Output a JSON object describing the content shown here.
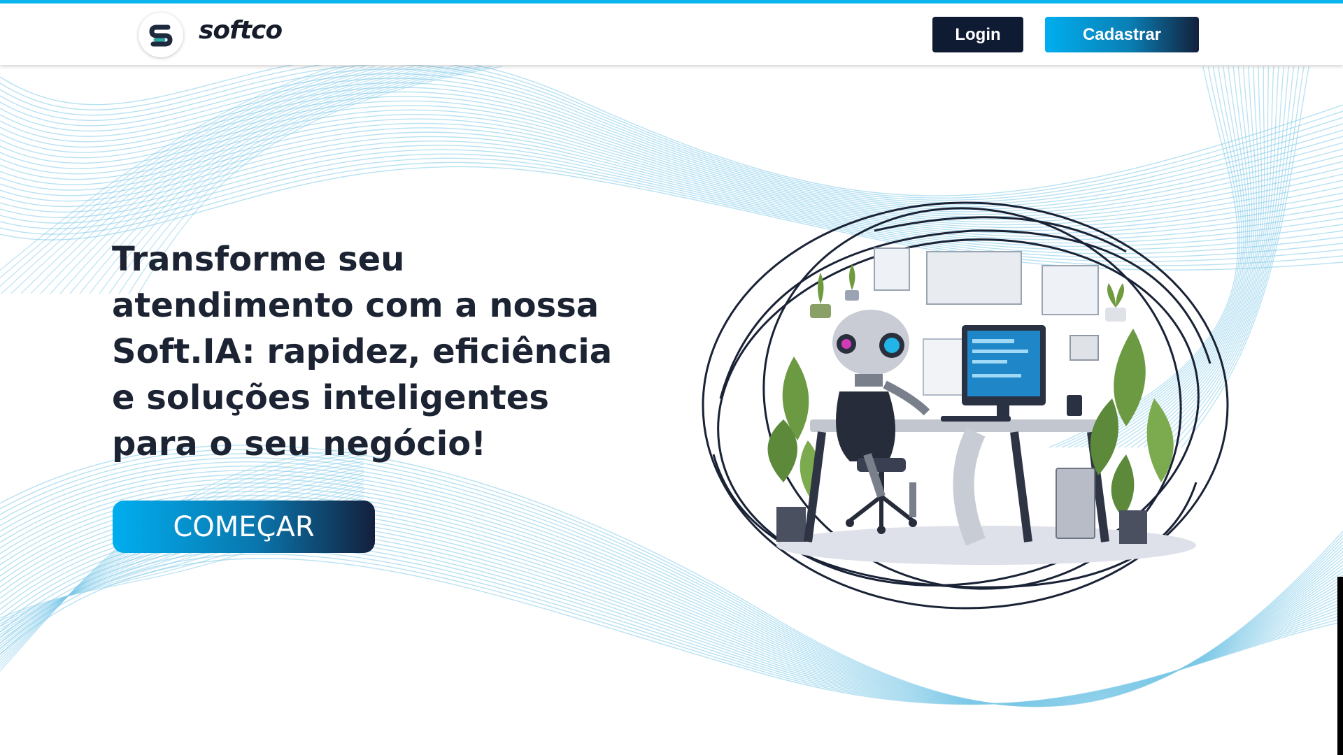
{
  "header": {
    "brand_name": "softco",
    "login_label": "Login",
    "signup_label": "Cadastrar"
  },
  "hero": {
    "title": "Transforme seu atendimento com a nossa Soft.IA: rapidez, eficiência e soluções inteligentes para o seu negócio!",
    "cta_label": "COMEÇAR"
  },
  "icons": {
    "logo": "softco-logo-icon",
    "illustration": "robot-at-desk-illustration"
  },
  "colors": {
    "accent": "#00aeef",
    "navy": "#0f1a33",
    "text": "#1c2333",
    "wave": "#7cc8e8"
  }
}
